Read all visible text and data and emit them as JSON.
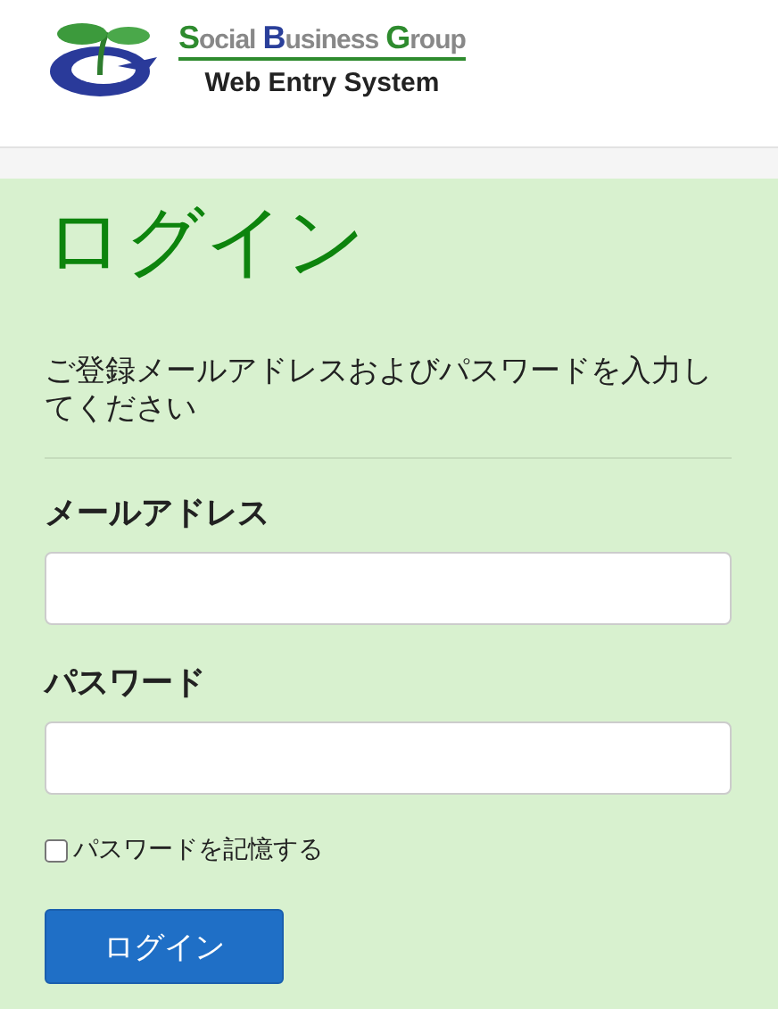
{
  "header": {
    "brand_words": [
      {
        "initial": "S",
        "rest": "ocial",
        "color": "#2e8b2e"
      },
      {
        "initial": "B",
        "rest": "usiness",
        "color": "#2a3f9a"
      },
      {
        "initial": "G",
        "rest": "roup",
        "color": "#2e8b2e"
      }
    ],
    "subtitle": "Web Entry System"
  },
  "title": "ログイン",
  "instruction": "ご登録メールアドレスおよびパスワードを入力してください",
  "fields": [
    {
      "label": "メールアドレス"
    },
    {
      "label": "パスワード"
    }
  ],
  "remember": {
    "label": "パスワードを記憶する",
    "checked": false
  },
  "submit": "ログイン"
}
